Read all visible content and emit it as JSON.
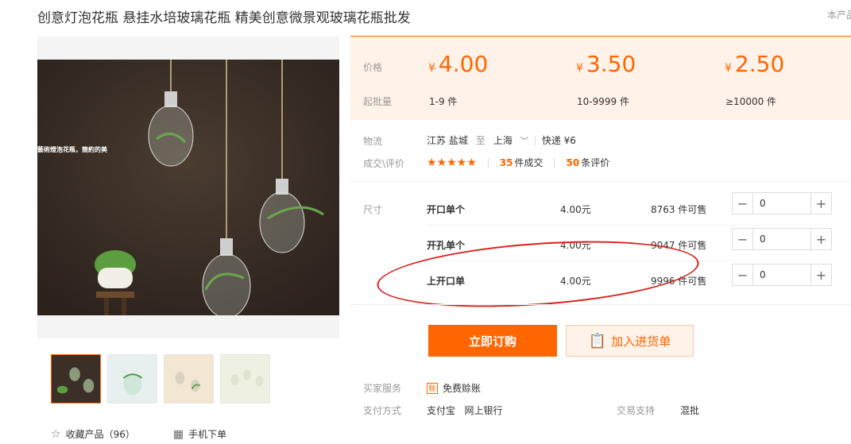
{
  "product": {
    "title": "创意灯泡花瓶 悬挂水培玻璃花瓶 精美创意微景观玻璃花瓶批发",
    "store_tag": "本产品",
    "image_caption": "藝術燈泡花瓶，簡約的美"
  },
  "price_box": {
    "price_label": "价格",
    "moq_label": "起批量",
    "currency": "¥",
    "tiers": [
      {
        "price": "4.00",
        "range": "1-9 件"
      },
      {
        "price": "3.50",
        "range": "10-9999 件"
      },
      {
        "price": "2.50",
        "range": "≥10000 件"
      }
    ]
  },
  "logistics": {
    "label": "物流",
    "from": "江苏 盐城",
    "to_word": "至",
    "to": "上海",
    "express": "快递 ¥6"
  },
  "rating": {
    "label": "成交\\评价",
    "stars": "★★★★★",
    "deals_count": "35",
    "deals_text": "件成交",
    "reviews_count": "50",
    "reviews_text": "条评价"
  },
  "sku": {
    "label": "尺寸",
    "items": [
      {
        "name": "开口单个",
        "price": "4.00元",
        "stock": "8763 件可售",
        "qty": "0"
      },
      {
        "name": "开孔单个",
        "price": "4.00元",
        "stock": "9047 件可售",
        "qty": "0"
      },
      {
        "name": "上开口单",
        "price": "4.00元",
        "stock": "9996 件可售",
        "qty": "0"
      }
    ]
  },
  "actions": {
    "buy": "立即订购",
    "cart": "加入进货单"
  },
  "services": {
    "buyer_label": "买家服务",
    "buyer_value": "免费赊账",
    "buyer_badge": "赊",
    "pay_label": "支付方式",
    "pay_values": "支付宝   网上银行",
    "trade_label": "交易支持",
    "trade_value": "混批"
  },
  "left_footer": {
    "favorite": "收藏产品（96）",
    "mobile": "手机下单"
  },
  "colors": {
    "accent": "#ff6600",
    "price_bg": "#fff2e8",
    "annotation": "#d9211b"
  }
}
